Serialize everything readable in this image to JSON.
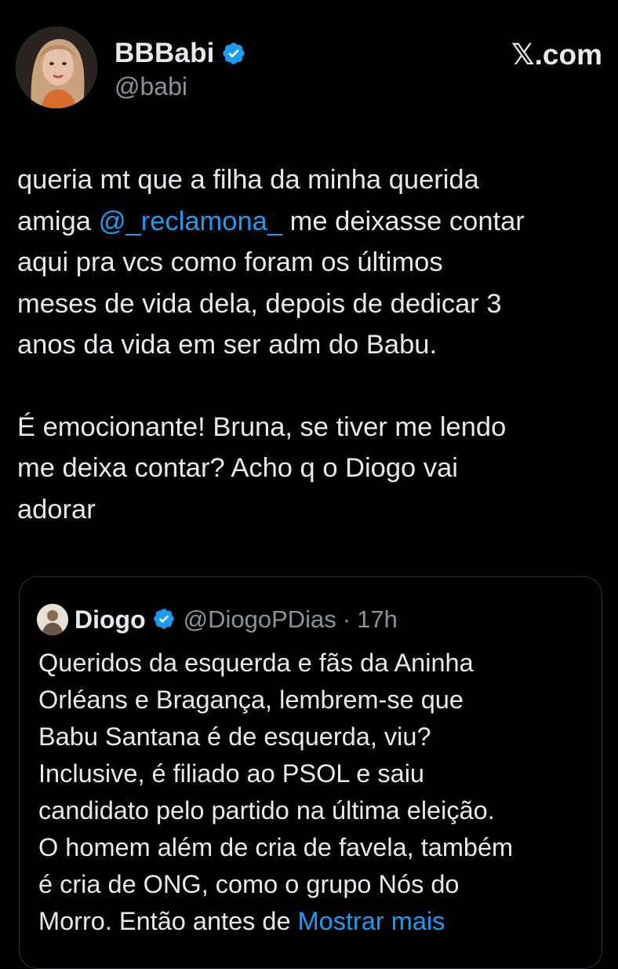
{
  "author": {
    "name": "BBBabi",
    "handle": "@babi"
  },
  "brand": "𝕏.com",
  "tweet": {
    "line1": "queria mt que a filha da minha querida",
    "line2_prefix": "amiga ",
    "mention": "@_reclamona_",
    "line2_suffix": " me deixasse contar",
    "line3": "aqui pra vcs como foram os últimos",
    "line4": "meses de vida dela, depois de dedicar 3",
    "line5": "anos da vida em ser adm do Babu.",
    "para2_line1": "É emocionante! Bruna, se tiver me lendo",
    "para2_line2": "me deixa contar? Acho q o Diogo vai",
    "para2_line3": "adorar"
  },
  "quote": {
    "name": "Diogo",
    "handle": "@DiogoPDias",
    "separator": "·",
    "time": "17h",
    "lines": [
      "Queridos da esquerda e fãs da Aninha",
      "Orléans e Bragança, lembrem-se que",
      "Babu Santana é de esquerda, viu?",
      "Inclusive, é filiado ao PSOL e saiu",
      "candidato pelo partido na última eleição.",
      "O homem além de cria de favela, também",
      "é cria de ONG, como o grupo Nós do"
    ],
    "last_line": "Morro. Então antes de ",
    "show_more": "Mostrar mais"
  },
  "colors": {
    "background": "#000000",
    "text": "#e7e9ea",
    "secondary": "#8b9298",
    "link": "#1d9bf0",
    "border": "#2f3336"
  },
  "icons": [
    "verified-badge-icon",
    "avatar-photo"
  ]
}
